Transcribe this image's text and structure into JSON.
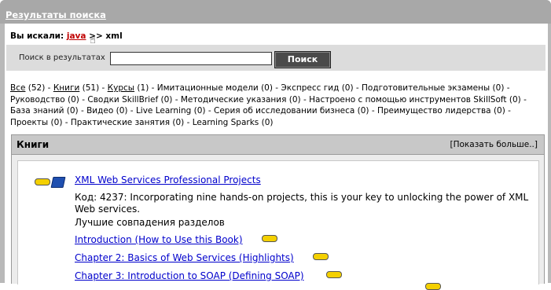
{
  "header": {
    "title": "Результаты поиска"
  },
  "query": {
    "prefix": "Вы искали:",
    "term": "java",
    "separator": ">>",
    "refinement": "xml"
  },
  "search": {
    "label": "Поиск в результатах",
    "value": "",
    "button": "Поиск"
  },
  "filters": [
    {
      "label": "Все",
      "count": "(52)",
      "link": true
    },
    {
      "label": "Книги",
      "count": "(51)",
      "link": true
    },
    {
      "label": "Курсы",
      "count": "(1)",
      "link": true
    },
    {
      "label": "Имитационные модели",
      "count": "(0)",
      "link": false
    },
    {
      "label": "Экспресс гид",
      "count": "(0)",
      "link": false
    },
    {
      "label": "Подготовительные экзамены",
      "count": "(0)",
      "link": false
    },
    {
      "label": "Руководство",
      "count": "(0)",
      "link": false
    },
    {
      "label": "Сводки SkillBrief",
      "count": "(0)",
      "link": false
    },
    {
      "label": "Методические указания",
      "count": "(0)",
      "link": false
    },
    {
      "label": "Настроено с помощью инструментов SkillSoft",
      "count": "(0)",
      "link": false
    },
    {
      "label": "База знаний",
      "count": "(0)",
      "link": false
    },
    {
      "label": "Видео",
      "count": "(0)",
      "link": false
    },
    {
      "label": "Live Learning",
      "count": "(0)",
      "link": false
    },
    {
      "label": "Серия об исследовании бизнеса",
      "count": "(0)",
      "link": false
    },
    {
      "label": "Преимущество лидерства",
      "count": "(0)",
      "link": false
    },
    {
      "label": "Проекты",
      "count": "(0)",
      "link": false
    },
    {
      "label": "Практические занятия",
      "count": "(0)",
      "link": false
    },
    {
      "label": "Learning Sparks",
      "count": "(0)",
      "link": false
    }
  ],
  "panel": {
    "title": "Книги",
    "show_more": "[Показать больше..]",
    "book": {
      "title": "XML Web Services Professional Projects",
      "description": "Код: 4237: Incorporating nine hands-on projects, this is your key to unlocking the power of XML Web services.",
      "best_matches_label": "Лучшие совпадения разделов",
      "chapters": [
        "Introduction (How to Use this Book)",
        "Chapter 2: Basics of Web Services (Highlights)",
        "Chapter 3: Introduction to SOAP (Defining SOAP)"
      ]
    }
  },
  "colors": {
    "title_bar": "#a8a8a8",
    "link": "#0000cc",
    "query_link": "#c00000",
    "pill": "#f4d000",
    "button": "#4a4a4a"
  },
  "icons": [
    "book-icon",
    "relevance-pill-icon",
    "pointer-cursor-icon"
  ]
}
